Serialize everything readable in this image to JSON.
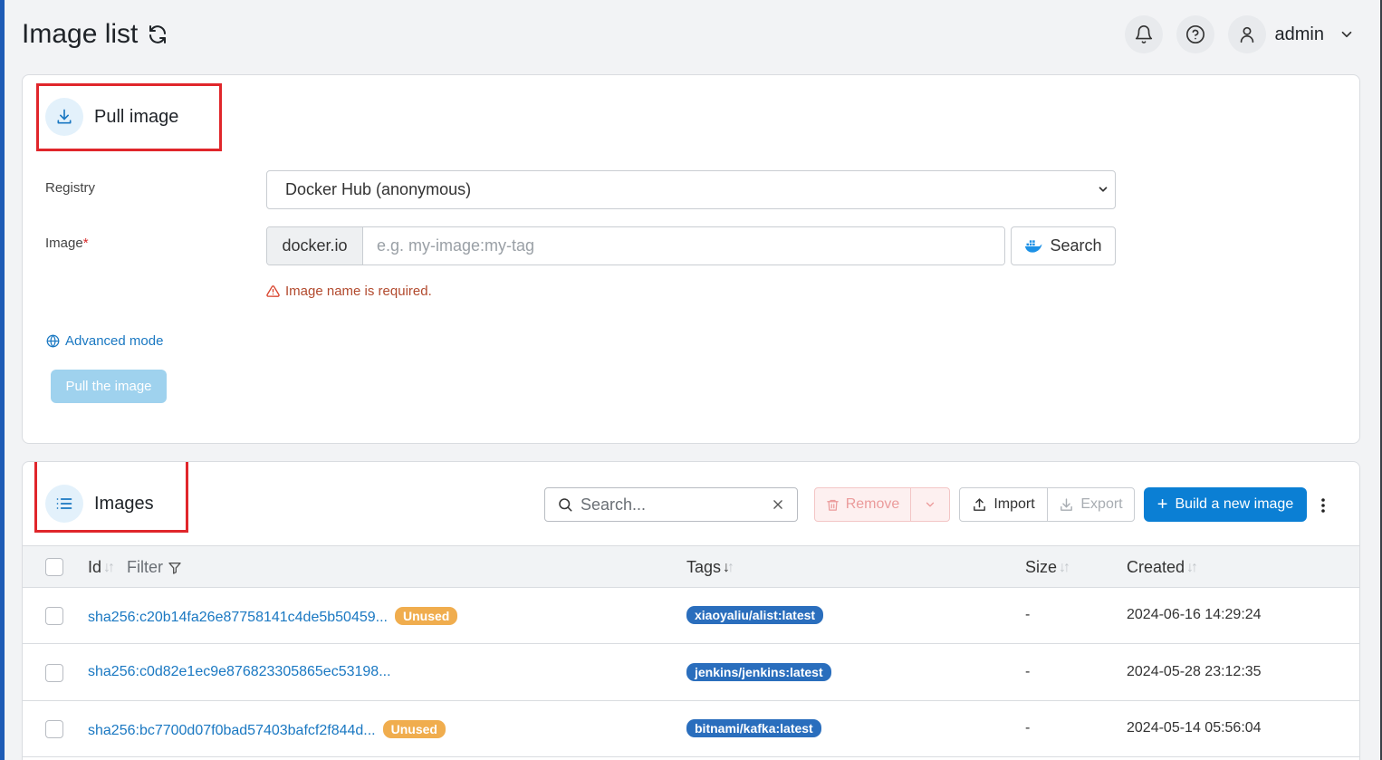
{
  "header": {
    "title": "Image list",
    "user": "admin"
  },
  "pull": {
    "title": "Pull image",
    "registry_label": "Registry",
    "registry_value": "Docker Hub (anonymous)",
    "image_label": "Image",
    "required_mark": "*",
    "prefix": "docker.io",
    "image_placeholder": "e.g. my-image:my-tag",
    "search_label": "Search",
    "error": "Image name is required.",
    "advanced": "Advanced mode",
    "pull_button": "Pull the image"
  },
  "images": {
    "title": "Images",
    "search_placeholder": "Search...",
    "remove": "Remove",
    "import": "Import",
    "export": "Export",
    "build": "Build a new image",
    "columns": {
      "id": "Id",
      "filter": "Filter",
      "tags": "Tags",
      "size": "Size",
      "created": "Created"
    },
    "rows": [
      {
        "id": "sha256:c20b14fa26e87758141c4de5b50459...",
        "badge": "Unused",
        "tag": "xiaoyaliu/alist:latest",
        "size": "-",
        "created": "2024-06-16 14:29:24"
      },
      {
        "id": "sha256:c0d82e1ec9e876823305865ec53198...",
        "badge": "",
        "tag": "jenkins/jenkins:latest",
        "size": "-",
        "created": "2024-05-28 23:12:35"
      },
      {
        "id": "sha256:bc7700d07f0bad57403bafcf2f844d...",
        "badge": "Unused",
        "tag": "bitnami/kafka:latest",
        "size": "-",
        "created": "2024-05-14 05:56:04"
      }
    ]
  },
  "colors": {
    "accent": "#0b7fd4",
    "link": "#1a78c2",
    "unused_badge": "#f0ad4e",
    "tag_badge": "#2a6ebd",
    "highlight_box": "#e0262b"
  }
}
